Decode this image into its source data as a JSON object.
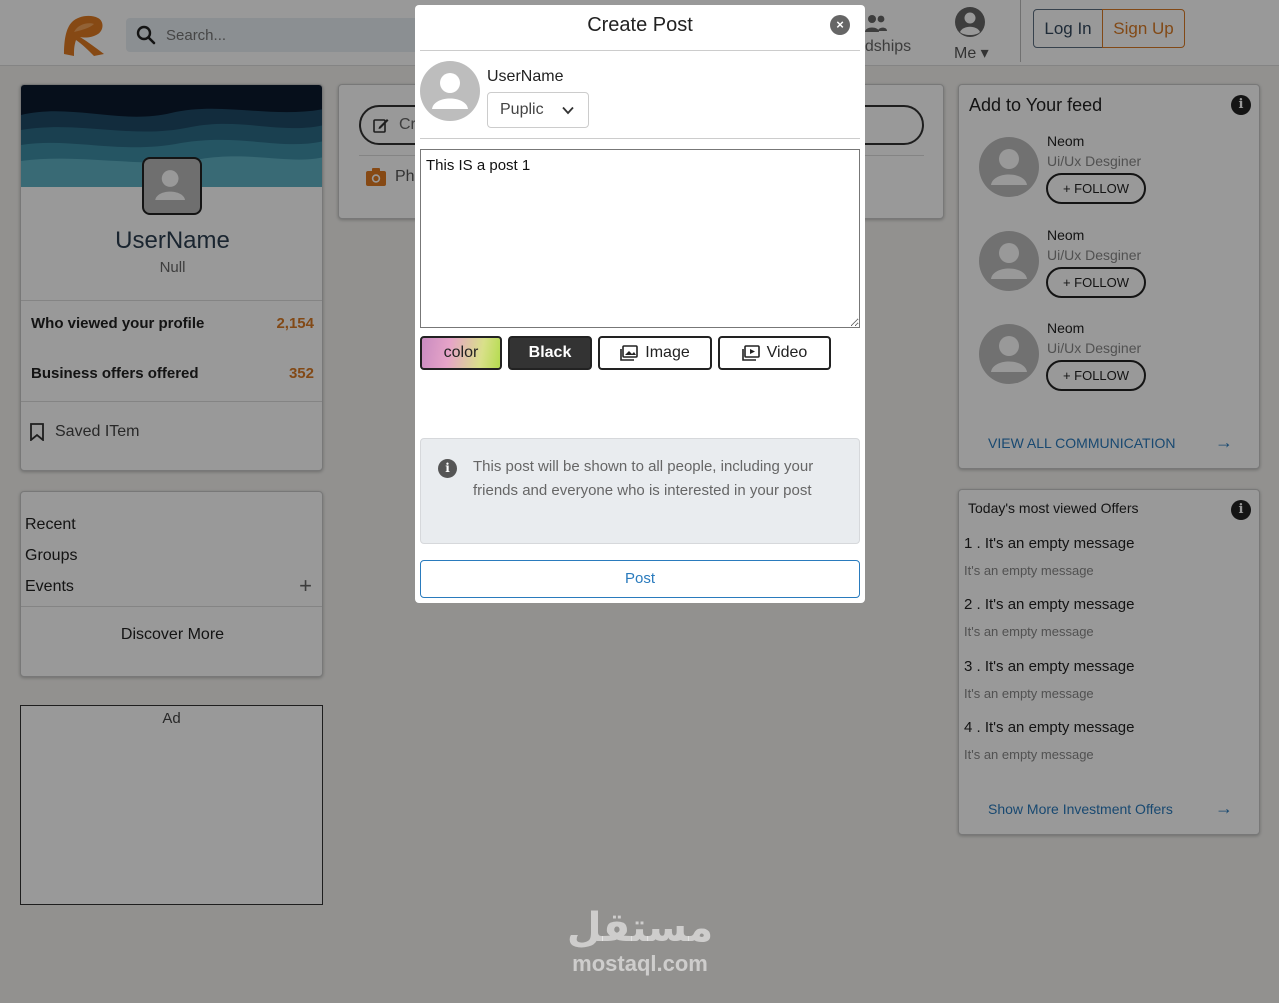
{
  "header": {
    "search_placeholder": "Search...",
    "nav_friendships": "ndships",
    "nav_me": "Me ▾",
    "login": "Log In",
    "signup": "Sign Up"
  },
  "profile": {
    "username": "UserName",
    "subtitle": "Null",
    "stats": [
      {
        "label": "Who viewed your profile",
        "value": "2,154"
      },
      {
        "label": "Business offers offered",
        "value": "352"
      }
    ],
    "saved": "Saved ITem"
  },
  "groups": {
    "items": [
      "Recent",
      "Groups",
      "Events"
    ],
    "add": "+",
    "discover": "Discover More"
  },
  "ad": {
    "label": "Ad"
  },
  "postbox": {
    "create": "Cre",
    "photo": "Pho"
  },
  "feed": {
    "title": "Add to Your feed",
    "people": [
      {
        "name": "Neom",
        "role": "Ui/Ux Desginer",
        "follow": "+ FOLLOW"
      },
      {
        "name": "Neom",
        "role": "Ui/Ux Desginer",
        "follow": "+ FOLLOW"
      },
      {
        "name": "Neom",
        "role": "Ui/Ux Desginer",
        "follow": "+ FOLLOW"
      }
    ],
    "view_all": "VIEW ALL COMMUNICATION",
    "arrow": "→"
  },
  "offers": {
    "title": "Today's most viewed Offers",
    "items": [
      {
        "heading": "1 . It's an empty message",
        "sub": "It's an empty message"
      },
      {
        "heading": "2 . It's an empty message",
        "sub": "It's an empty message"
      },
      {
        "heading": "3 . It's an empty message",
        "sub": "It's an empty message"
      },
      {
        "heading": "4 . It's an empty message",
        "sub": "It's an empty message"
      }
    ],
    "show_more": "Show More Investment Offers",
    "arrow": "→"
  },
  "modal": {
    "title": "Create Post",
    "close": "×",
    "username": "UserName",
    "audience": "Puplic",
    "post_text": "This IS a post 1",
    "buttons": {
      "color": "color",
      "black": "Black",
      "image": "Image",
      "video": "Video"
    },
    "notice": "This post will be shown to all people, including your friends and everyone who is interested in your post",
    "post_button": "Post"
  },
  "watermark": {
    "arabic": "مستقل",
    "latin": "mostaql.com"
  },
  "colors": {
    "accent_orange": "#d97b26",
    "link_blue": "#2a7bbd",
    "overlay": "rgba(0,0,0,0.40)"
  }
}
